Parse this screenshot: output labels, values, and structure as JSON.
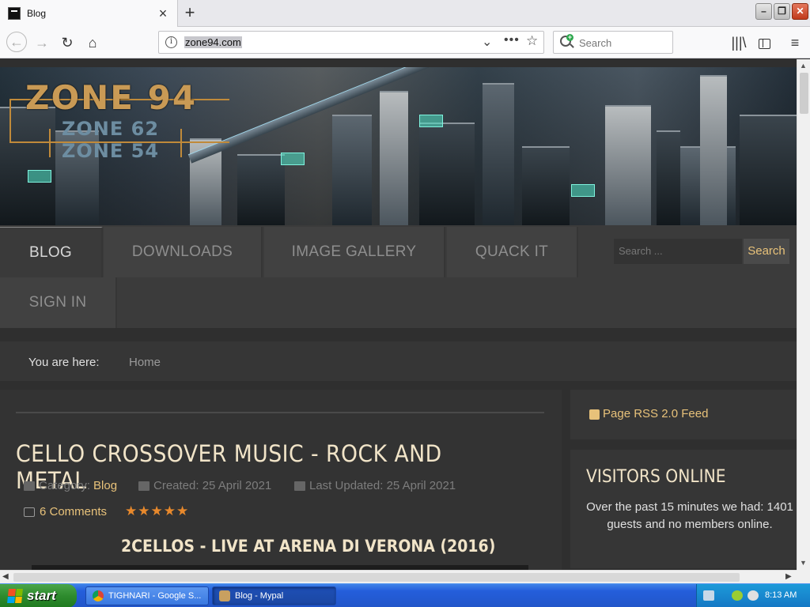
{
  "browser": {
    "tab_title": "Blog",
    "url": "zone94.com",
    "search_placeholder": "Search",
    "new_tab": "+",
    "close_tab": "×"
  },
  "site": {
    "logo": {
      "main": "ZONE 94",
      "sub1": "ZONE 62",
      "sub2": "ZONE 54"
    },
    "menu": {
      "items": [
        {
          "label": "BLOG"
        },
        {
          "label": "DOWNLOADS"
        },
        {
          "label": "IMAGE GALLERY"
        },
        {
          "label": "QUACK IT"
        },
        {
          "label": "SIGN IN"
        }
      ],
      "search_placeholder": "Search ...",
      "search_button": "Search"
    },
    "breadcrumb": {
      "label": "You are here:",
      "home": "Home"
    },
    "article": {
      "title": "CELLO CROSSOVER MUSIC - ROCK AND METAL",
      "category_label": "Category:",
      "category": "Blog",
      "created": "Created: 25 April 2021",
      "updated": "Last Updated: 25 April 2021",
      "comments": "6 Comments",
      "rating": 5,
      "stars": "★★★★★",
      "video_title": "2CELLOS - LIVE AT ARENA DI VERONA (2016)"
    },
    "sidebar": {
      "rss": "Page RSS 2.0 Feed",
      "visitors_title": "VISITORS ONLINE",
      "visitors_text": "Over the past 15 minutes we had: 1401 guests and no members online."
    }
  },
  "taskbar": {
    "start": "start",
    "tasks": [
      {
        "label": "TIGHNARI - Google S..."
      },
      {
        "label": "Blog - Mypal"
      }
    ],
    "clock": "8:13 AM"
  },
  "colors": {
    "accent": "#e8c27a",
    "heading": "#f1e4c8",
    "menu_bg": "#414141"
  }
}
